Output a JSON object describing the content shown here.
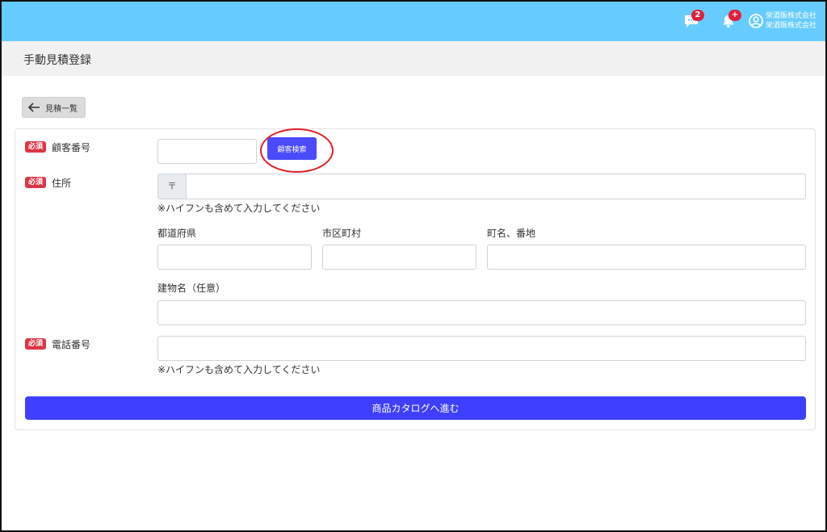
{
  "header": {
    "messages_badge": "2",
    "notifications_badge": "+",
    "company_line1": "栄酒販株式会社",
    "company_line2": "栄酒販株式会社"
  },
  "page": {
    "title": "手動見積登録",
    "back_label": "見積一覧"
  },
  "form": {
    "required_label": "必須",
    "customer_number": {
      "label": "顧客番号",
      "value": "",
      "search_button": "顧客検索"
    },
    "address": {
      "label": "住所",
      "postal_prefix": "〒",
      "postal_value": "",
      "hint": "※ハイフンも含めて入力してください",
      "prefecture_label": "都道府県",
      "city_label": "市区町村",
      "town_label": "町名、番地",
      "building_label": "建物名（任意）"
    },
    "phone": {
      "label": "電話番号",
      "value": "",
      "hint": "※ハイフンも含めて入力してください"
    },
    "next_button": "商品カタログへ進む"
  },
  "colors": {
    "topbar": "#66ccff",
    "required": "#dc3545",
    "primary": "#3f3fff",
    "annotation_circle": "#e0202a"
  }
}
